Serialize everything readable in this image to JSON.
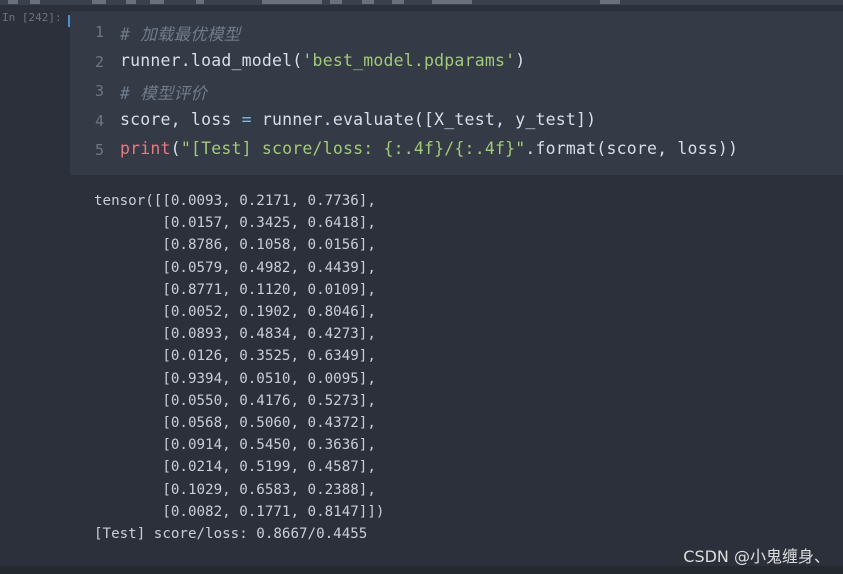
{
  "cell": {
    "prompt": "In [242]:",
    "lines": [
      {
        "no": "1",
        "segments": [
          {
            "t": "# 加载最优模型",
            "c": "comment"
          }
        ]
      },
      {
        "no": "2",
        "segments": [
          {
            "t": "runner.load_model(",
            "c": "plain"
          },
          {
            "t": "'best_model.pdparams'",
            "c": "string"
          },
          {
            "t": ")",
            "c": "plain"
          }
        ]
      },
      {
        "no": "3",
        "segments": [
          {
            "t": "# 模型评价",
            "c": "comment"
          }
        ]
      },
      {
        "no": "4",
        "segments": [
          {
            "t": "score, loss ",
            "c": "plain"
          },
          {
            "t": "=",
            "c": "op"
          },
          {
            "t": " runner.evaluate([X_test, y_test])",
            "c": "plain"
          }
        ]
      },
      {
        "no": "5",
        "segments": [
          {
            "t": "print",
            "c": "print"
          },
          {
            "t": "(",
            "c": "plain"
          },
          {
            "t": "\"[Test] score/loss: {:.4f}/{:.4f}\"",
            "c": "string"
          },
          {
            "t": ".format(score, loss))",
            "c": "plain"
          }
        ]
      }
    ]
  },
  "output": {
    "lines": [
      "tensor([[0.0093, 0.2171, 0.7736],",
      "        [0.0157, 0.3425, 0.6418],",
      "        [0.8786, 0.1058, 0.0156],",
      "        [0.0579, 0.4982, 0.4439],",
      "        [0.8771, 0.1120, 0.0109],",
      "        [0.0052, 0.1902, 0.8046],",
      "        [0.0893, 0.4834, 0.4273],",
      "        [0.0126, 0.3525, 0.6349],",
      "        [0.9394, 0.0510, 0.0095],",
      "        [0.0550, 0.4176, 0.5273],",
      "        [0.0568, 0.5060, 0.4372],",
      "        [0.0914, 0.5450, 0.3636],",
      "        [0.0214, 0.5199, 0.4587],",
      "        [0.1029, 0.6583, 0.2388],",
      "        [0.0082, 0.1771, 0.8147]])",
      "[Test] score/loss: 0.8667/0.4455"
    ]
  },
  "watermark": "CSDN @小鬼缠身、"
}
